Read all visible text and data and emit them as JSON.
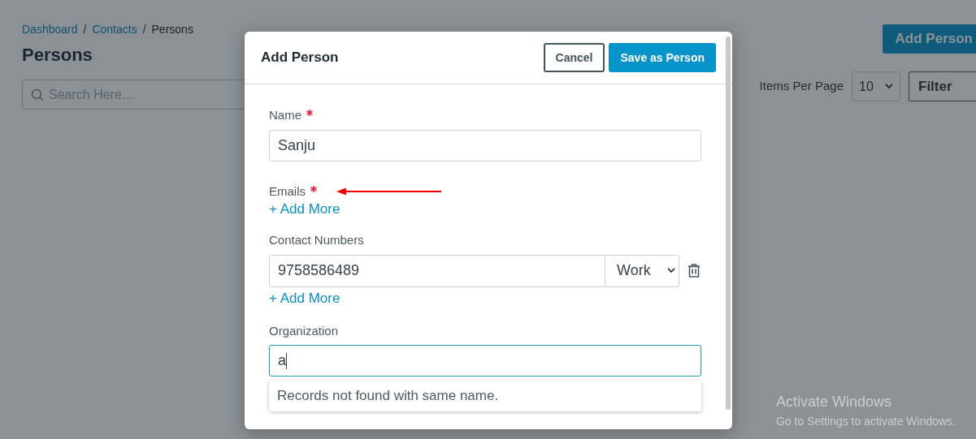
{
  "breadcrumb": [
    {
      "label": "Dashboard",
      "link": true
    },
    {
      "separator": "/",
      "label": "Contacts",
      "link": true
    },
    {
      "separator": "/",
      "label": "Persons",
      "link": false
    }
  ],
  "page_title": "Persons",
  "search": {
    "placeholder": "Search Here..."
  },
  "add_button": "Add Person",
  "items_per_page": {
    "label": "Items Per Page",
    "value": "10"
  },
  "filter": {
    "value": "Filter"
  },
  "modal": {
    "title": "Add Person",
    "cancel": "Cancel",
    "save": "Save as Person",
    "fields": [
      {
        "kind": "text",
        "label": "Name",
        "required": true,
        "value": "Sanju"
      },
      {
        "kind": "list",
        "label": "Emails",
        "required": true,
        "annotated": true,
        "add_more": "+ Add More"
      },
      {
        "kind": "phone",
        "label": "Contact Numbers",
        "required": false,
        "value": "9758586489",
        "type": "Work",
        "add_more": "+ Add More"
      },
      {
        "kind": "autocomplete",
        "label": "Organization",
        "required": false,
        "value": "a",
        "focused": true,
        "suggestion": "Records not found with same name."
      }
    ]
  },
  "os_notice": {
    "title": "Activate Windows",
    "subtitle": "Go to Settings to activate Windows."
  }
}
